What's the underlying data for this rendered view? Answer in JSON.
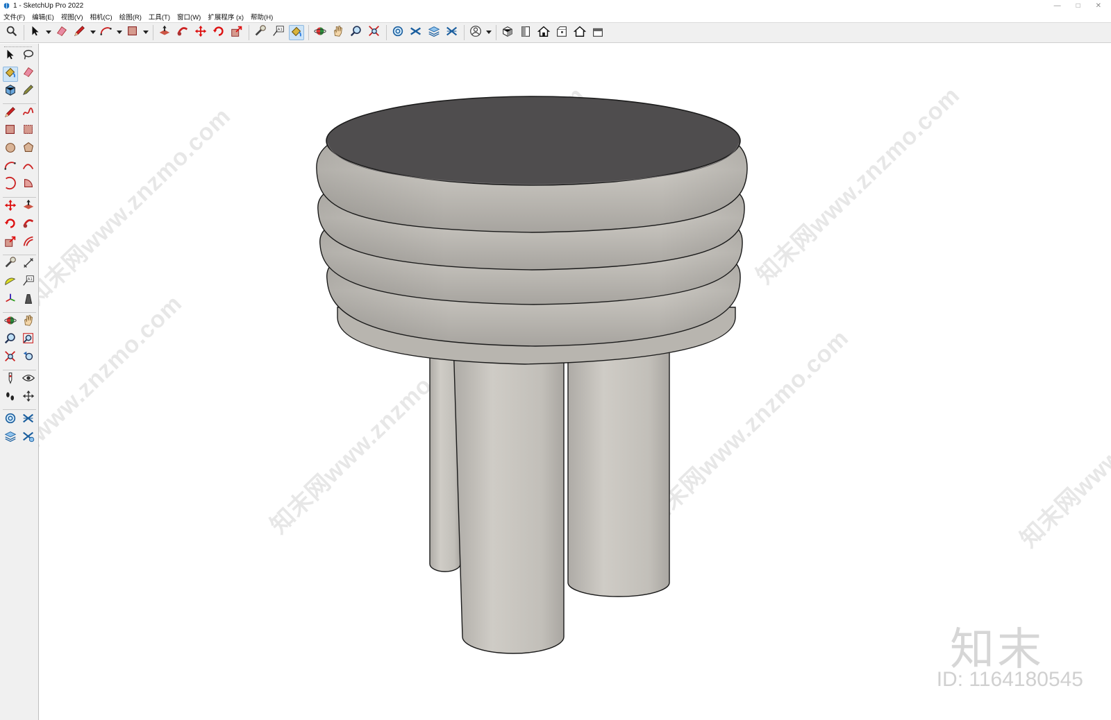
{
  "window": {
    "title": "1 - SketchUp Pro 2022",
    "controls": [
      "—",
      "□",
      "✕"
    ]
  },
  "menu": [
    "文件(F)",
    "编辑(E)",
    "视图(V)",
    "相机(C)",
    "绘图(R)",
    "工具(T)",
    "窗口(W)",
    "扩展程序 (x)",
    "帮助(H)"
  ],
  "toolbar": {
    "items": [
      {
        "icon": "search-icon"
      },
      {
        "sep": true
      },
      {
        "icon": "select-arrow-icon"
      },
      {
        "drop": true
      },
      {
        "icon": "eraser-icon"
      },
      {
        "icon": "pencil-line-icon"
      },
      {
        "drop": true
      },
      {
        "icon": "arc-icon"
      },
      {
        "drop": true
      },
      {
        "icon": "rectangle-icon"
      },
      {
        "drop": true
      },
      {
        "sep": true
      },
      {
        "icon": "push-pull-icon"
      },
      {
        "icon": "follow-me-icon"
      },
      {
        "icon": "move-icon"
      },
      {
        "icon": "rotate-icon"
      },
      {
        "icon": "scale-icon"
      },
      {
        "sep": true
      },
      {
        "icon": "tape-measure-icon"
      },
      {
        "icon": "text-label-icon"
      },
      {
        "icon": "paint-bucket-icon",
        "active": true
      },
      {
        "sep": true
      },
      {
        "icon": "orbit-icon"
      },
      {
        "icon": "pan-hand-icon"
      },
      {
        "icon": "zoom-icon"
      },
      {
        "icon": "zoom-extents-icon"
      },
      {
        "sep": true
      },
      {
        "icon": "sandbox-icon"
      },
      {
        "icon": "tags-icon"
      },
      {
        "icon": "layers-icon"
      },
      {
        "icon": "section-icon"
      },
      {
        "sep": true
      },
      {
        "icon": "user-account-icon"
      },
      {
        "drop": true
      },
      {
        "sep": true
      },
      {
        "icon": "iso-view-icon"
      },
      {
        "icon": "top-view-icon"
      },
      {
        "icon": "front-view-icon"
      },
      {
        "icon": "right-view-icon"
      },
      {
        "icon": "back-view-icon"
      },
      {
        "icon": "left-view-icon"
      }
    ]
  },
  "left_toolbar": {
    "rows": [
      [
        "select-arrow-icon",
        "lasso-icon"
      ],
      [
        "paint-bucket-icon",
        "eraser-icon"
      ],
      [
        "component-icon",
        "tag-pencil-icon"
      ],
      null,
      [
        "pencil-line-icon",
        "freehand-icon"
      ],
      [
        "rectangle-icon",
        "rotated-rectangle-icon"
      ],
      [
        "circle-icon",
        "polygon-icon"
      ],
      [
        "arc-icon",
        "two-point-arc-icon"
      ],
      [
        "three-point-arc-icon",
        "pie-icon"
      ],
      null,
      [
        "move-icon",
        "push-pull-icon"
      ],
      [
        "rotate-icon",
        "follow-me-icon"
      ],
      [
        "scale-icon",
        "offset-icon"
      ],
      null,
      [
        "tape-measure-icon",
        "dimension-icon"
      ],
      [
        "protractor-icon",
        "text-label-icon"
      ],
      [
        "axes-icon",
        "3d-text-icon"
      ],
      null,
      [
        "orbit-icon",
        "pan-hand-icon"
      ],
      [
        "zoom-icon",
        "zoom-window-icon"
      ],
      [
        "zoom-extents-icon",
        "previous-view-icon"
      ],
      null,
      [
        "position-camera-icon",
        "look-around-icon"
      ],
      [
        "walk-icon",
        "section-plane-icon"
      ],
      null,
      [
        "sandbox-icon",
        "section-icon"
      ],
      [
        "layers-icon",
        "section-fill-icon"
      ]
    ],
    "active": "paint-bucket-icon"
  },
  "watermark": {
    "text": "知末网www.znzmo.com",
    "logo": "知末",
    "id": "ID: 1164180545"
  },
  "colors": {
    "seat_top": "#4f4d4e",
    "seat_body": "#bfbcb6",
    "leg": "#c6c3bd",
    "outline": "#1a1a1a",
    "accent": "#cde4f7"
  }
}
